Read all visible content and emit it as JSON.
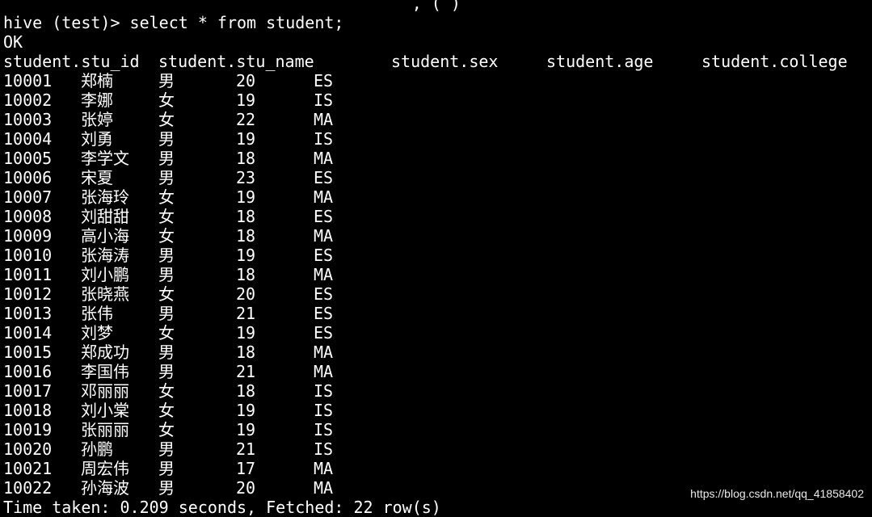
{
  "terminal": {
    "top_fragment": "                                          , ( )",
    "prompt": "hive (test)> select * from student;",
    "status": "OK",
    "headers": [
      "student.stu_id",
      "student.stu_name",
      "student.sex",
      "student.age",
      "student.college"
    ],
    "rows": [
      [
        "10001",
        "郑楠",
        "男",
        "20",
        "ES"
      ],
      [
        "10002",
        "李娜",
        "女",
        "19",
        "IS"
      ],
      [
        "10003",
        "张婷",
        "女",
        "22",
        "MA"
      ],
      [
        "10004",
        "刘勇",
        "男",
        "19",
        "IS"
      ],
      [
        "10005",
        "李学文",
        "男",
        "18",
        "MA"
      ],
      [
        "10006",
        "宋夏",
        "男",
        "23",
        "ES"
      ],
      [
        "10007",
        "张海玲",
        "女",
        "19",
        "MA"
      ],
      [
        "10008",
        "刘甜甜",
        "女",
        "18",
        "ES"
      ],
      [
        "10009",
        "高小海",
        "女",
        "18",
        "MA"
      ],
      [
        "10010",
        "张海涛",
        "男",
        "19",
        "ES"
      ],
      [
        "10011",
        "刘小鹏",
        "男",
        "18",
        "MA"
      ],
      [
        "10012",
        "张晓燕",
        "女",
        "20",
        "ES"
      ],
      [
        "10013",
        "张伟",
        "男",
        "21",
        "ES"
      ],
      [
        "10014",
        "刘梦",
        "女",
        "19",
        "ES"
      ],
      [
        "10015",
        "郑成功",
        "男",
        "18",
        "MA"
      ],
      [
        "10016",
        "李国伟",
        "男",
        "21",
        "MA"
      ],
      [
        "10017",
        "邓丽丽",
        "女",
        "18",
        "IS"
      ],
      [
        "10018",
        "刘小棠",
        "女",
        "19",
        "IS"
      ],
      [
        "10019",
        "张丽丽",
        "女",
        "19",
        "IS"
      ],
      [
        "10020",
        "孙鹏",
        "男",
        "21",
        "IS"
      ],
      [
        "10021",
        "周宏伟",
        "男",
        "17",
        "MA"
      ],
      [
        "10022",
        "孙海波",
        "男",
        "20",
        "MA"
      ]
    ],
    "footer": "Time taken: 0.209 seconds, Fetched: 22 row(s)"
  },
  "watermark": "https://blog.csdn.net/qq_41858402",
  "colors": {
    "background": "#000000",
    "foreground": "#ffffff"
  }
}
